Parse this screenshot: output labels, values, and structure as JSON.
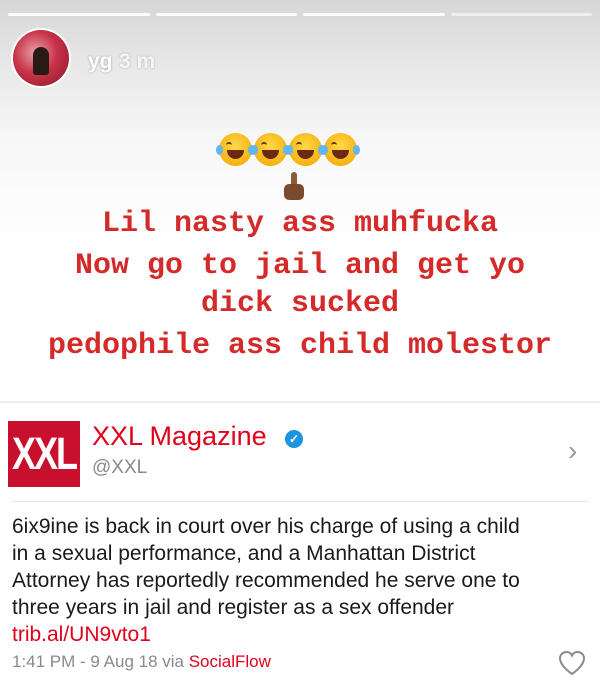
{
  "story": {
    "username": "yg",
    "timestamp": "3 m",
    "progress": [
      {
        "state": "done"
      },
      {
        "state": "done"
      },
      {
        "state": "current"
      },
      {
        "state": "pending"
      }
    ],
    "emojis": [
      "face-with-tears-of-joy",
      "face-with-tears-of-joy",
      "face-with-tears-of-joy",
      "face-with-tears-of-joy"
    ],
    "pointer_emoji": "pointing-down-hand-dark-skin",
    "caption_color": "#d42a2a",
    "caption_lines": [
      "Lil nasty ass muhfucka",
      "Now go to jail and get yo",
      "dick sucked",
      "pedophile ass child molestor"
    ]
  },
  "tweet": {
    "logo_text": "XXL",
    "brand_color": "#c8102e",
    "display_name": "XXL Magazine",
    "verified": true,
    "handle": "@XXL",
    "body_lines": [
      "6ix9ine is back in court over his charge of using a child",
      "in a sexual performance, and a Manhattan District",
      "Attorney has reportedly recommended he serve one to",
      "three years in jail and register as a sex offender"
    ],
    "link": "trib.al/UN9vto1",
    "meta_prefix": "1:41 PM - 9 Aug 18 via ",
    "source": "SocialFlow",
    "chevron": "›"
  }
}
